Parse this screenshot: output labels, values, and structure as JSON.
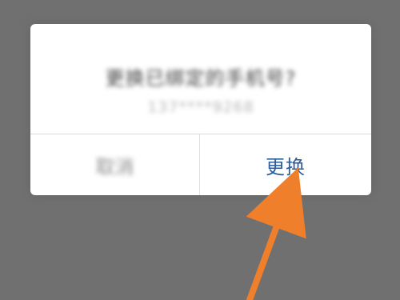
{
  "dialog": {
    "title": "更换已绑定的手机号?",
    "phone_number": "137****9268",
    "cancel_label": "取消",
    "confirm_label": "更换"
  },
  "annotation": {
    "arrow_color": "#f07f2b"
  },
  "colors": {
    "overlay": "#707070",
    "dialog_background": "#ffffff",
    "confirm_text": "#2d5c9a",
    "cancel_text": "#8f8f8f"
  }
}
